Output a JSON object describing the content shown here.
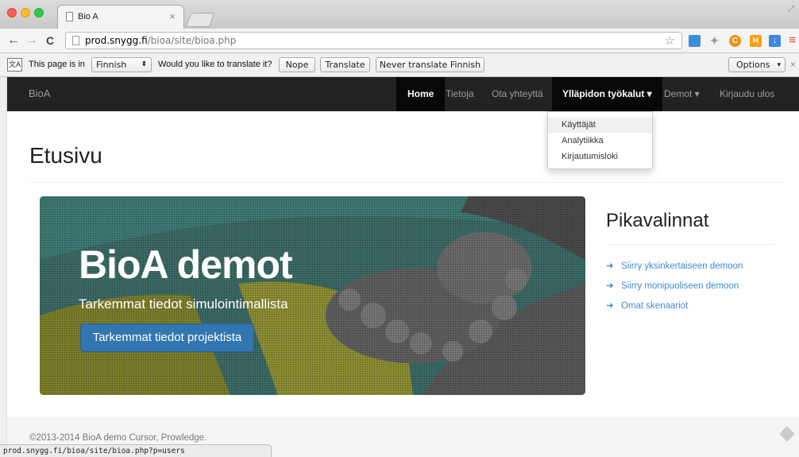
{
  "browser": {
    "tab_title": "Bio A",
    "tab_close": "×",
    "url_host": "prod.snygg.fi",
    "url_path": "/bioa/site/bioa.php",
    "back_glyph": "←",
    "forward_glyph": "→",
    "reload_glyph": "C",
    "star_glyph": "☆",
    "extensions": [
      {
        "name": "google-icon",
        "glyph": "",
        "color": "#3a8fd6"
      },
      {
        "name": "puzzle-icon",
        "glyph": "✦",
        "color": "#9a9a9a"
      },
      {
        "name": "c-icon",
        "glyph": "C",
        "color": "#f29019"
      },
      {
        "name": "h-icon",
        "glyph": "H",
        "color": "#f6a019"
      },
      {
        "name": "download-icon",
        "glyph": "↓",
        "color": "#3f87e0"
      }
    ],
    "menu_glyph": "≡",
    "status_url": "prod.snygg.fi/bioa/site/bioa.php?p=users"
  },
  "translate_bar": {
    "icon_label": "文A",
    "prefix": "This page is in",
    "language": "Finnish",
    "question": "Would you like to translate it?",
    "nope": "Nope",
    "translate": "Translate",
    "never": "Never translate Finnish",
    "options": "Options",
    "close": "×"
  },
  "navbar": {
    "brand": "BioA",
    "items": [
      {
        "label": "Home"
      },
      {
        "label": "Tietoja"
      },
      {
        "label": "Ota yhteyttä"
      },
      {
        "label": "Ylläpidon työkalut ▾"
      },
      {
        "label": "Demot ▾"
      },
      {
        "label": "Kirjaudu ulos"
      }
    ]
  },
  "dropdown": {
    "items": [
      {
        "label": "Käyttäjät"
      },
      {
        "label": "Analytiikka"
      },
      {
        "label": "Kirjautumisloki"
      }
    ]
  },
  "page": {
    "title": "Etusivu"
  },
  "hero": {
    "title": "BioA demot",
    "subtitle": "Tarkemmat tiedot simulointimallista",
    "button": "Tarkemmat tiedot projektista"
  },
  "sidebar": {
    "title": "Pikavalinnat",
    "links": [
      {
        "label": "Siirry yksinkertaiseen demoon"
      },
      {
        "label": "Siirry monipuoliseen demoon"
      },
      {
        "label": "Omat skenaariot"
      }
    ]
  },
  "footer": {
    "text": "©2013-2014 BioA demo Cursor, Prowledge."
  },
  "colors": {
    "navbar_bg": "#222222",
    "link": "#428bca",
    "primary_button": "#3276b1"
  }
}
